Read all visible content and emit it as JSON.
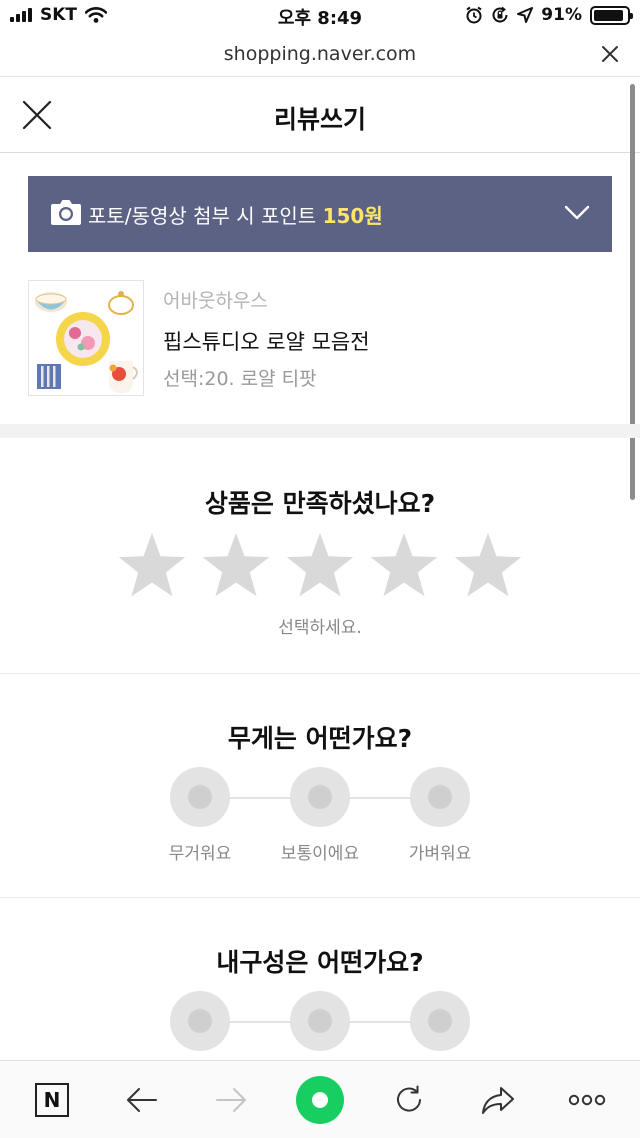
{
  "status_bar": {
    "carrier": "SKT",
    "time": "오후 8:49",
    "battery_percent": "91%",
    "battery_level": 0.91,
    "icons": [
      "signal-icon",
      "wifi-icon",
      "alarm-icon",
      "rotation-lock-icon",
      "location-icon",
      "battery-icon"
    ]
  },
  "browser": {
    "url": "shopping.naver.com"
  },
  "header": {
    "title": "리뷰쓰기"
  },
  "banner": {
    "text": "포토/동영상 첨부 시 포인트 ",
    "highlight": "150원",
    "background": "#5b6283",
    "highlight_color": "#ffe36a"
  },
  "product": {
    "brand": "어바웃하우스",
    "name": "핍스튜디오 로얄 모음전",
    "option": "선택:20. 로얄 티팟"
  },
  "rating": {
    "question": "상품은 만족하셨나요?",
    "hint": "선택하세요.",
    "max_stars": 5,
    "selected_stars": 0
  },
  "weight": {
    "question": "무게는 어떤가요?",
    "options": [
      "무거워요",
      "보통이에요",
      "가벼워요"
    ]
  },
  "durability": {
    "question": "내구성은 어떤가요?"
  },
  "toolbar": {
    "home_label": "N",
    "accent": "#19ce60"
  }
}
